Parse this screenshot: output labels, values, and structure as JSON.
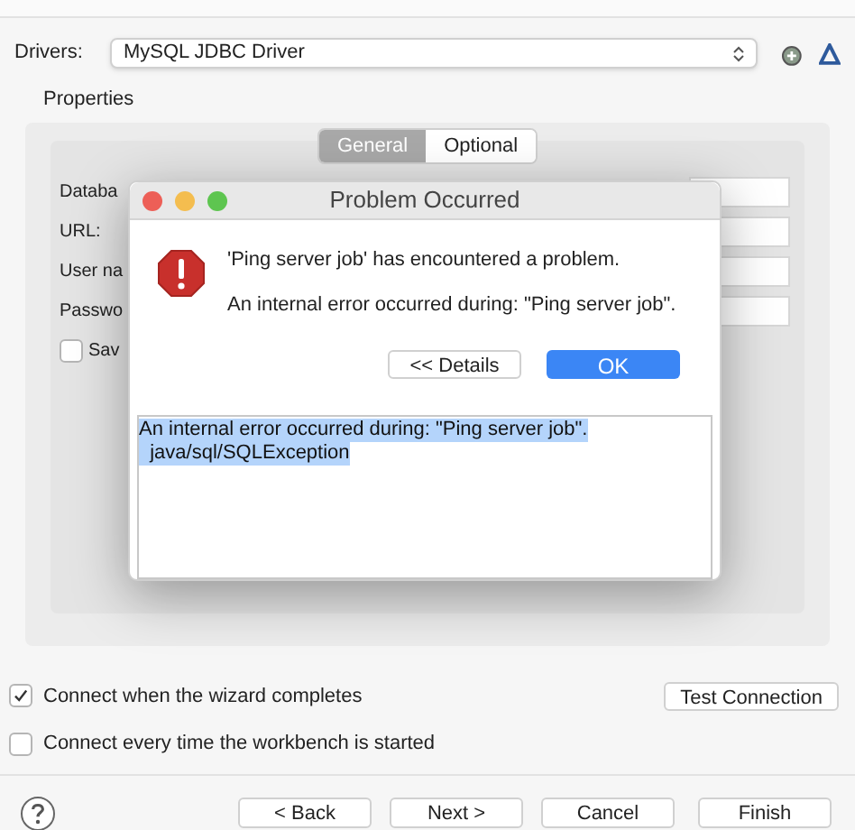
{
  "drivers": {
    "label": "Drivers:",
    "value": "MySQL JDBC Driver"
  },
  "properties": {
    "title": "Properties",
    "tabs": [
      {
        "label": "General",
        "selected": true
      },
      {
        "label": "Optional",
        "selected": false
      }
    ],
    "fields": [
      {
        "kind": "text",
        "label": "Databa"
      },
      {
        "kind": "text",
        "label": "URL:"
      },
      {
        "kind": "text",
        "label": "User na"
      },
      {
        "kind": "text",
        "label": "Passwo"
      },
      {
        "kind": "checkbox",
        "label": "Sav",
        "checked": false
      }
    ]
  },
  "dialog": {
    "title": "Problem Occurred",
    "message": "'Ping server job' has encountered a problem.",
    "detail": "An internal error occurred during: \"Ping server job\".",
    "buttons": [
      {
        "label": "<< Details",
        "default": false
      },
      {
        "label": "OK",
        "default": true
      }
    ],
    "details_lines": [
      {
        "text": "An internal error occurred during: \"Ping server job\".",
        "selected": true
      },
      {
        "text": "  java/sql/SQLException",
        "selected": true
      }
    ]
  },
  "options": [
    {
      "label": "Connect when the wizard completes",
      "checked": true
    },
    {
      "label": "Connect every time the workbench is started",
      "checked": false
    }
  ],
  "test_button": "Test Connection",
  "footer_buttons": [
    "< Back",
    "Next >",
    "Cancel",
    "Finish"
  ]
}
